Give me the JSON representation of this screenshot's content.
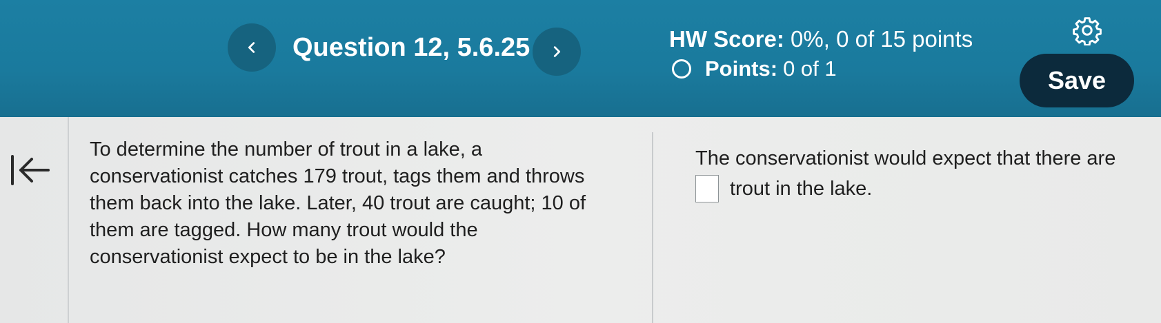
{
  "header": {
    "question_title": "Question 12, 5.6.25",
    "hw_score_label": "HW Score:",
    "hw_score_value": "0%, 0 of 15 points",
    "points_label": "Points:",
    "points_value": "0 of 1",
    "save_label": "Save",
    "icons": {
      "prev": "chevron-left-icon",
      "next": "chevron-right-icon",
      "settings": "gear-icon",
      "status": "empty-circle-icon"
    }
  },
  "sidebar": {
    "collapse_icon": "collapse-left-icon"
  },
  "question": {
    "text": "To determine the number of trout in a lake, a conservationist catches 179 trout, tags them and throws them back into the lake. Later, 40 trout are caught; 10 of them are tagged. How many trout would the conservationist expect to be in the lake?"
  },
  "answer": {
    "prefix": "The conservationist would expect that there are",
    "input_value": "",
    "suffix": "trout in the lake."
  },
  "colors": {
    "header_bg": "#1a7a9d",
    "nav_button_bg": "#16637f",
    "save_button_bg": "#0c2a3c",
    "content_bg": "#e9eaea",
    "text": "#1f1f1f"
  }
}
